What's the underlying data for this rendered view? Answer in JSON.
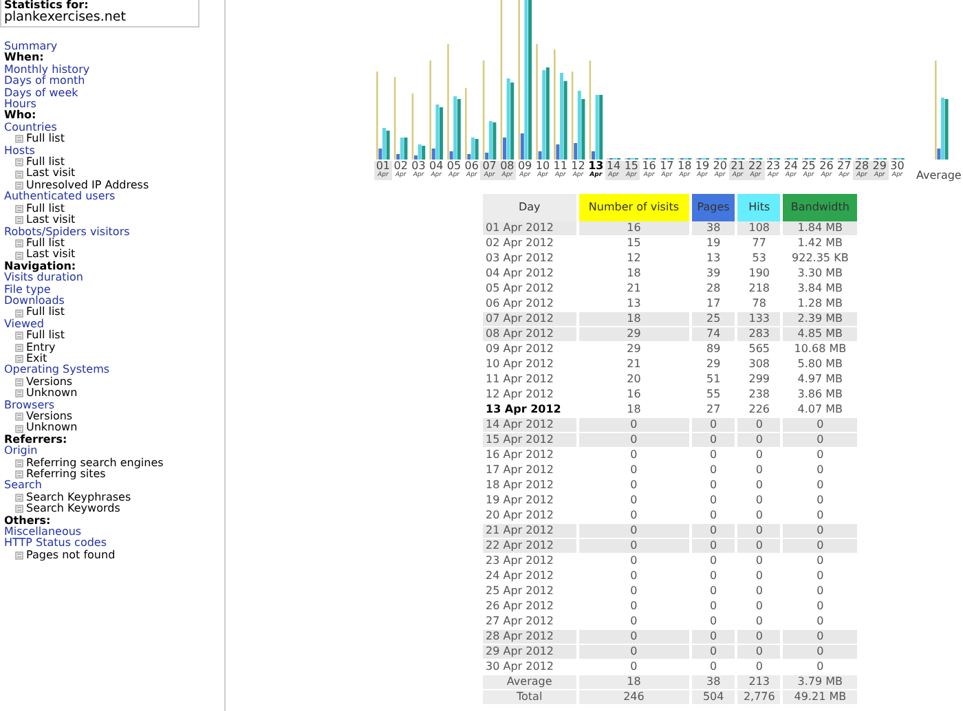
{
  "header": {
    "label": "Statistics for:",
    "site": "plankexercises.net"
  },
  "menu": [
    {
      "kind": "link",
      "text": "Summary"
    },
    {
      "kind": "heading",
      "text": "When:"
    },
    {
      "kind": "link",
      "text": "Monthly history"
    },
    {
      "kind": "link",
      "text": "Days of month"
    },
    {
      "kind": "link",
      "text": "Days of week"
    },
    {
      "kind": "link",
      "text": "Hours"
    },
    {
      "kind": "heading",
      "text": "Who:"
    },
    {
      "kind": "link",
      "text": "Countries",
      "children": [
        {
          "text": "Full list"
        }
      ]
    },
    {
      "kind": "link",
      "text": "Hosts",
      "children": [
        {
          "text": "Full list"
        },
        {
          "text": "Last visit"
        },
        {
          "text": "Unresolved IP Address"
        }
      ]
    },
    {
      "kind": "link",
      "text": "Authenticated users",
      "children": [
        {
          "text": "Full list"
        },
        {
          "text": "Last visit"
        }
      ]
    },
    {
      "kind": "link",
      "text": "Robots/Spiders visitors",
      "children": [
        {
          "text": "Full list"
        },
        {
          "text": "Last visit"
        }
      ]
    },
    {
      "kind": "heading",
      "text": "Navigation:"
    },
    {
      "kind": "link",
      "text": "Visits duration"
    },
    {
      "kind": "link",
      "text": "File type"
    },
    {
      "kind": "link",
      "text": "Downloads",
      "children": [
        {
          "text": "Full list"
        }
      ]
    },
    {
      "kind": "link",
      "text": "Viewed",
      "children": [
        {
          "text": "Full list"
        },
        {
          "text": "Entry"
        },
        {
          "text": "Exit"
        }
      ]
    },
    {
      "kind": "link",
      "text": "Operating Systems",
      "children": [
        {
          "text": "Versions"
        },
        {
          "text": "Unknown"
        }
      ]
    },
    {
      "kind": "link",
      "text": "Browsers",
      "children": [
        {
          "text": "Versions"
        },
        {
          "text": "Unknown"
        }
      ]
    },
    {
      "kind": "heading",
      "text": "Referrers:"
    },
    {
      "kind": "link",
      "text": "Origin",
      "children": [
        {
          "text": "Referring search engines"
        },
        {
          "text": "Referring sites"
        }
      ]
    },
    {
      "kind": "link",
      "text": "Search",
      "children": [
        {
          "text": "Search Keyphrases"
        },
        {
          "text": "Search Keywords"
        }
      ]
    },
    {
      "kind": "heading",
      "text": "Others:"
    },
    {
      "kind": "link",
      "text": "Miscellaneous"
    },
    {
      "kind": "link",
      "text": "HTTP Status codes",
      "children": [
        {
          "text": "Pages not found"
        }
      ]
    }
  ],
  "chart": {
    "day_labels": [
      {
        "day": "01",
        "month": "Apr",
        "weekend": true,
        "today": false
      },
      {
        "day": "02",
        "month": "Apr",
        "weekend": false,
        "today": false
      },
      {
        "day": "03",
        "month": "Apr",
        "weekend": false,
        "today": false
      },
      {
        "day": "04",
        "month": "Apr",
        "weekend": false,
        "today": false
      },
      {
        "day": "05",
        "month": "Apr",
        "weekend": false,
        "today": false
      },
      {
        "day": "06",
        "month": "Apr",
        "weekend": false,
        "today": false
      },
      {
        "day": "07",
        "month": "Apr",
        "weekend": true,
        "today": false
      },
      {
        "day": "08",
        "month": "Apr",
        "weekend": true,
        "today": false
      },
      {
        "day": "09",
        "month": "Apr",
        "weekend": false,
        "today": false
      },
      {
        "day": "10",
        "month": "Apr",
        "weekend": false,
        "today": false
      },
      {
        "day": "11",
        "month": "Apr",
        "weekend": false,
        "today": false
      },
      {
        "day": "12",
        "month": "Apr",
        "weekend": false,
        "today": false
      },
      {
        "day": "13",
        "month": "Apr",
        "weekend": false,
        "today": true
      },
      {
        "day": "14",
        "month": "Apr",
        "weekend": true,
        "today": false
      },
      {
        "day": "15",
        "month": "Apr",
        "weekend": true,
        "today": false
      },
      {
        "day": "16",
        "month": "Apr",
        "weekend": false,
        "today": false
      },
      {
        "day": "17",
        "month": "Apr",
        "weekend": false,
        "today": false
      },
      {
        "day": "18",
        "month": "Apr",
        "weekend": false,
        "today": false
      },
      {
        "day": "19",
        "month": "Apr",
        "weekend": false,
        "today": false
      },
      {
        "day": "20",
        "month": "Apr",
        "weekend": false,
        "today": false
      },
      {
        "day": "21",
        "month": "Apr",
        "weekend": true,
        "today": false
      },
      {
        "day": "22",
        "month": "Apr",
        "weekend": true,
        "today": false
      },
      {
        "day": "23",
        "month": "Apr",
        "weekend": false,
        "today": false
      },
      {
        "day": "24",
        "month": "Apr",
        "weekend": false,
        "today": false
      },
      {
        "day": "25",
        "month": "Apr",
        "weekend": false,
        "today": false
      },
      {
        "day": "26",
        "month": "Apr",
        "weekend": false,
        "today": false
      },
      {
        "day": "27",
        "month": "Apr",
        "weekend": false,
        "today": false
      },
      {
        "day": "28",
        "month": "Apr",
        "weekend": true,
        "today": false
      },
      {
        "day": "29",
        "month": "Apr",
        "weekend": true,
        "today": false
      },
      {
        "day": "30",
        "month": "Apr",
        "weekend": false,
        "today": false
      }
    ],
    "average_label": "Average"
  },
  "table": {
    "columns": [
      {
        "label": "Day",
        "color": "#ececec"
      },
      {
        "label": "Number of visits",
        "color": "#ffff00"
      },
      {
        "label": "Pages",
        "color": "#4477dd"
      },
      {
        "label": "Hits",
        "color": "#66eeff"
      },
      {
        "label": "Bandwidth",
        "color": "#2ea44f"
      }
    ],
    "rows": [
      {
        "cells": [
          "01 Apr 2012",
          "16",
          "38",
          "108",
          "1.84 MB"
        ],
        "weekend": true,
        "today": false
      },
      {
        "cells": [
          "02 Apr 2012",
          "15",
          "19",
          "77",
          "1.42 MB"
        ],
        "weekend": false,
        "today": false
      },
      {
        "cells": [
          "03 Apr 2012",
          "12",
          "13",
          "53",
          "922.35 KB"
        ],
        "weekend": false,
        "today": false
      },
      {
        "cells": [
          "04 Apr 2012",
          "18",
          "39",
          "190",
          "3.30 MB"
        ],
        "weekend": false,
        "today": false
      },
      {
        "cells": [
          "05 Apr 2012",
          "21",
          "28",
          "218",
          "3.84 MB"
        ],
        "weekend": false,
        "today": false
      },
      {
        "cells": [
          "06 Apr 2012",
          "13",
          "17",
          "78",
          "1.28 MB"
        ],
        "weekend": false,
        "today": false
      },
      {
        "cells": [
          "07 Apr 2012",
          "18",
          "25",
          "133",
          "2.39 MB"
        ],
        "weekend": true,
        "today": false
      },
      {
        "cells": [
          "08 Apr 2012",
          "29",
          "74",
          "283",
          "4.85 MB"
        ],
        "weekend": true,
        "today": false
      },
      {
        "cells": [
          "09 Apr 2012",
          "29",
          "89",
          "565",
          "10.68 MB"
        ],
        "weekend": false,
        "today": false
      },
      {
        "cells": [
          "10 Apr 2012",
          "21",
          "29",
          "308",
          "5.80 MB"
        ],
        "weekend": false,
        "today": false
      },
      {
        "cells": [
          "11 Apr 2012",
          "20",
          "51",
          "299",
          "4.97 MB"
        ],
        "weekend": false,
        "today": false
      },
      {
        "cells": [
          "12 Apr 2012",
          "16",
          "55",
          "238",
          "3.86 MB"
        ],
        "weekend": false,
        "today": false
      },
      {
        "cells": [
          "13 Apr 2012",
          "18",
          "27",
          "226",
          "4.07 MB"
        ],
        "weekend": false,
        "today": true
      },
      {
        "cells": [
          "14 Apr 2012",
          "0",
          "0",
          "0",
          "0"
        ],
        "weekend": true,
        "today": false
      },
      {
        "cells": [
          "15 Apr 2012",
          "0",
          "0",
          "0",
          "0"
        ],
        "weekend": true,
        "today": false
      },
      {
        "cells": [
          "16 Apr 2012",
          "0",
          "0",
          "0",
          "0"
        ],
        "weekend": false,
        "today": false
      },
      {
        "cells": [
          "17 Apr 2012",
          "0",
          "0",
          "0",
          "0"
        ],
        "weekend": false,
        "today": false
      },
      {
        "cells": [
          "18 Apr 2012",
          "0",
          "0",
          "0",
          "0"
        ],
        "weekend": false,
        "today": false
      },
      {
        "cells": [
          "19 Apr 2012",
          "0",
          "0",
          "0",
          "0"
        ],
        "weekend": false,
        "today": false
      },
      {
        "cells": [
          "20 Apr 2012",
          "0",
          "0",
          "0",
          "0"
        ],
        "weekend": false,
        "today": false
      },
      {
        "cells": [
          "21 Apr 2012",
          "0",
          "0",
          "0",
          "0"
        ],
        "weekend": true,
        "today": false
      },
      {
        "cells": [
          "22 Apr 2012",
          "0",
          "0",
          "0",
          "0"
        ],
        "weekend": true,
        "today": false
      },
      {
        "cells": [
          "23 Apr 2012",
          "0",
          "0",
          "0",
          "0"
        ],
        "weekend": false,
        "today": false
      },
      {
        "cells": [
          "24 Apr 2012",
          "0",
          "0",
          "0",
          "0"
        ],
        "weekend": false,
        "today": false
      },
      {
        "cells": [
          "25 Apr 2012",
          "0",
          "0",
          "0",
          "0"
        ],
        "weekend": false,
        "today": false
      },
      {
        "cells": [
          "26 Apr 2012",
          "0",
          "0",
          "0",
          "0"
        ],
        "weekend": false,
        "today": false
      },
      {
        "cells": [
          "27 Apr 2012",
          "0",
          "0",
          "0",
          "0"
        ],
        "weekend": false,
        "today": false
      },
      {
        "cells": [
          "28 Apr 2012",
          "0",
          "0",
          "0",
          "0"
        ],
        "weekend": true,
        "today": false
      },
      {
        "cells": [
          "29 Apr 2012",
          "0",
          "0",
          "0",
          "0"
        ],
        "weekend": true,
        "today": false
      },
      {
        "cells": [
          "30 Apr 2012",
          "0",
          "0",
          "0",
          "0"
        ],
        "weekend": false,
        "today": false
      }
    ],
    "footer": [
      {
        "cells": [
          "Average",
          "18",
          "38",
          "213",
          "3.79 MB"
        ]
      },
      {
        "cells": [
          "Total",
          "246",
          "504",
          "2,776",
          "49.21 MB"
        ]
      }
    ]
  }
}
